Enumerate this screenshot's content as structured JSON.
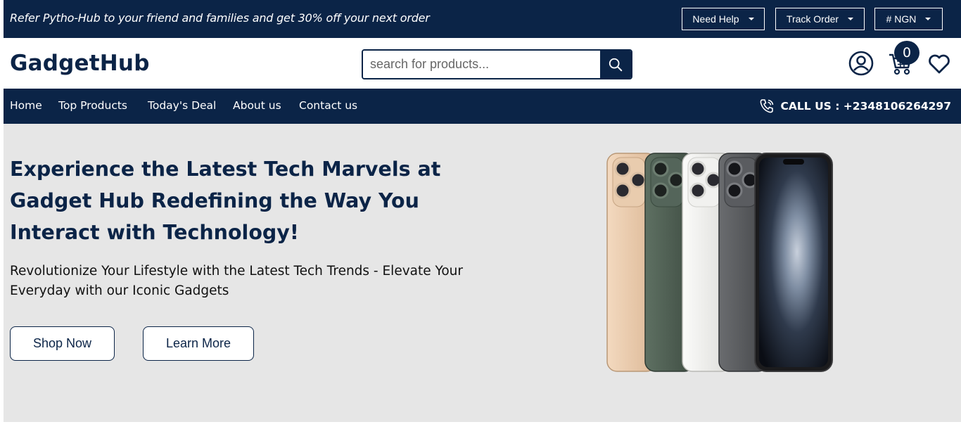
{
  "topbar": {
    "promo": "Refer Pytho-Hub to your friend and families and get 30% off your next order",
    "need_help": "Need Help",
    "track_order": "Track Order",
    "currency": "# NGN"
  },
  "header": {
    "logo": "GadgetHub",
    "search_placeholder": "search for products...",
    "cart_count": "0"
  },
  "nav": {
    "items": [
      "Home",
      "Top Products",
      "Today's Deal",
      "About us",
      "Contact us"
    ],
    "call": "CALL US : +2348106264297"
  },
  "hero": {
    "title": "Experience the Latest Tech Marvels at Gadget Hub Redefining the Way You Interact with Technology!",
    "subtitle": "Revolutionize Your Lifestyle with the Latest Tech Trends - Elevate Your Everyday with our Iconic Gadgets",
    "shop_now": "Shop Now",
    "learn_more": "Learn More"
  },
  "colors": {
    "brand": "#0b2447",
    "hero_bg": "#e6e6e6",
    "phone_gold": "#e8c9a9",
    "phone_green": "#4e5e52",
    "phone_silver": "#ededeb",
    "phone_space_gray": "#55575a",
    "phone_black": "#1b1b1d"
  },
  "icons": [
    "chevron-down-icon",
    "search-icon",
    "user-icon",
    "cart-icon",
    "heart-icon",
    "phone-call-icon"
  ]
}
